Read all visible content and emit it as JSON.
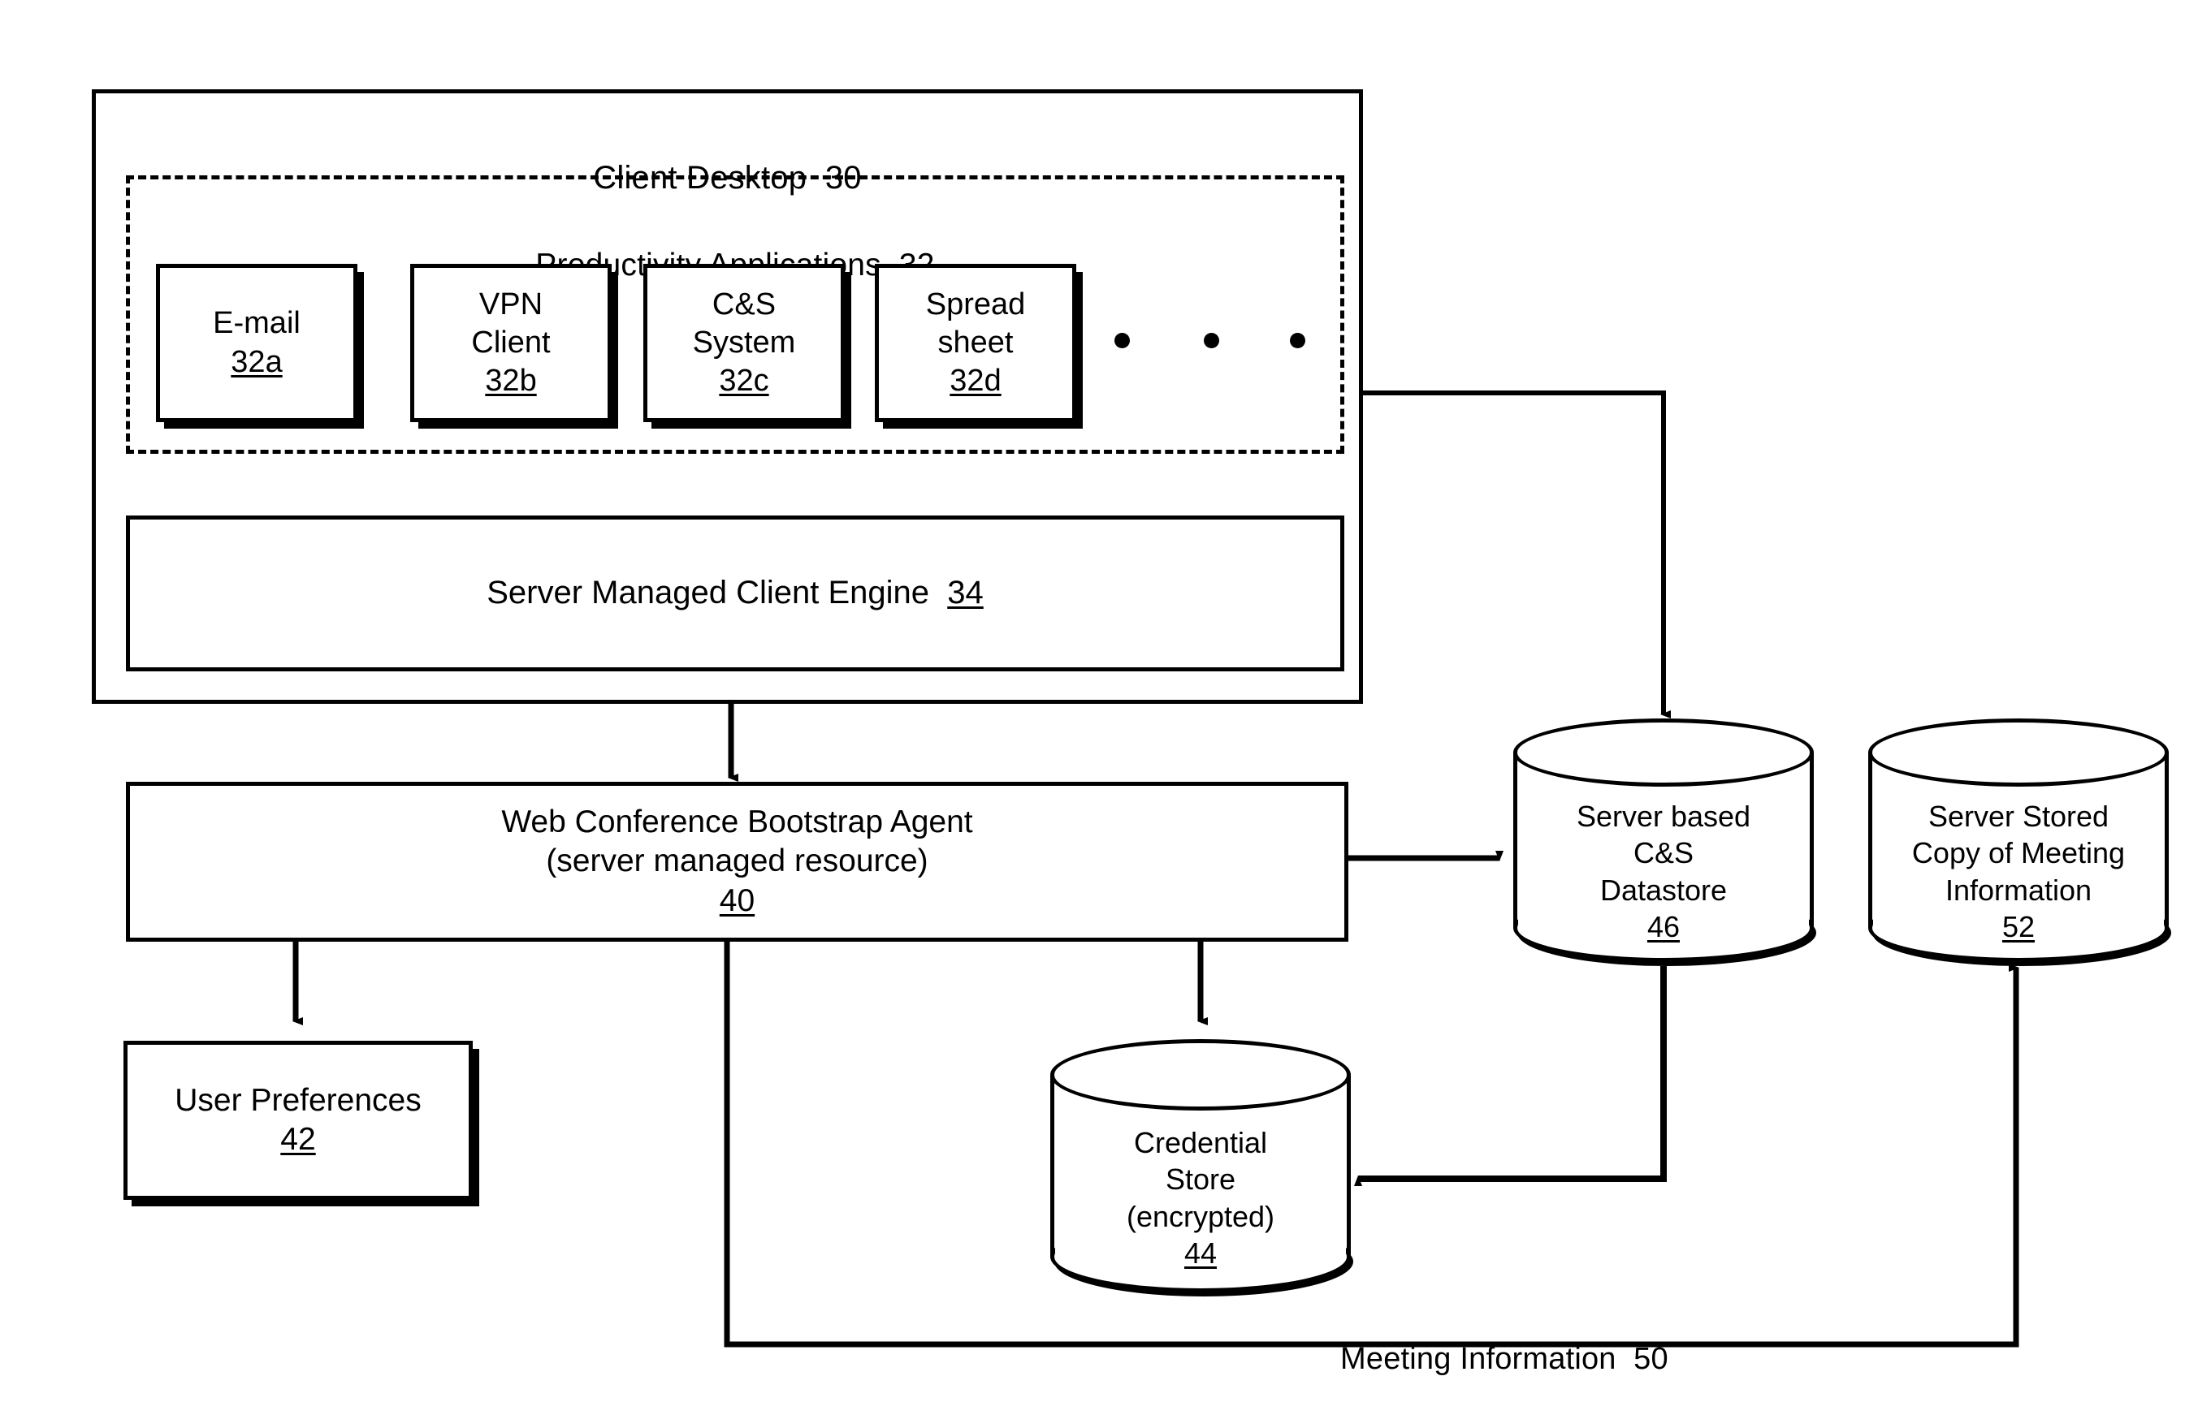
{
  "diagram": {
    "client_desktop": {
      "title": "Client Desktop",
      "ref": "30",
      "productivity": {
        "title": "Productivity Applications",
        "ref": "32",
        "apps": [
          {
            "name": "E-mail",
            "ref": "32a"
          },
          {
            "name": "VPN\nClient",
            "ref": "32b"
          },
          {
            "name": "C&S\nSystem",
            "ref": "32c"
          },
          {
            "name": "Spread\nsheet",
            "ref": "32d"
          }
        ],
        "ellipsis": "• • •"
      },
      "engine": {
        "title": "Server Managed Client Engine",
        "ref": "34"
      }
    },
    "bootstrap_agent": {
      "line1": "Web Conference Bootstrap Agent",
      "line2": "(server managed resource)",
      "ref": "40"
    },
    "user_preferences": {
      "title": "User Preferences",
      "ref": "42"
    },
    "credential_store": {
      "line1": "Credential",
      "line2": "Store",
      "line3": "(encrypted)",
      "ref": "44"
    },
    "cs_datastore": {
      "line1": "Server based",
      "line2": "C&S",
      "line3": "Datastore",
      "ref": "46"
    },
    "meeting_info_store": {
      "line1": "Server Stored",
      "line2": "Copy of Meeting",
      "line3": "Information",
      "ref": "52"
    },
    "meeting_information_flow": {
      "label": "Meeting Information",
      "ref": "50"
    },
    "colors": {
      "stroke": "#000000",
      "background": "#ffffff"
    }
  }
}
